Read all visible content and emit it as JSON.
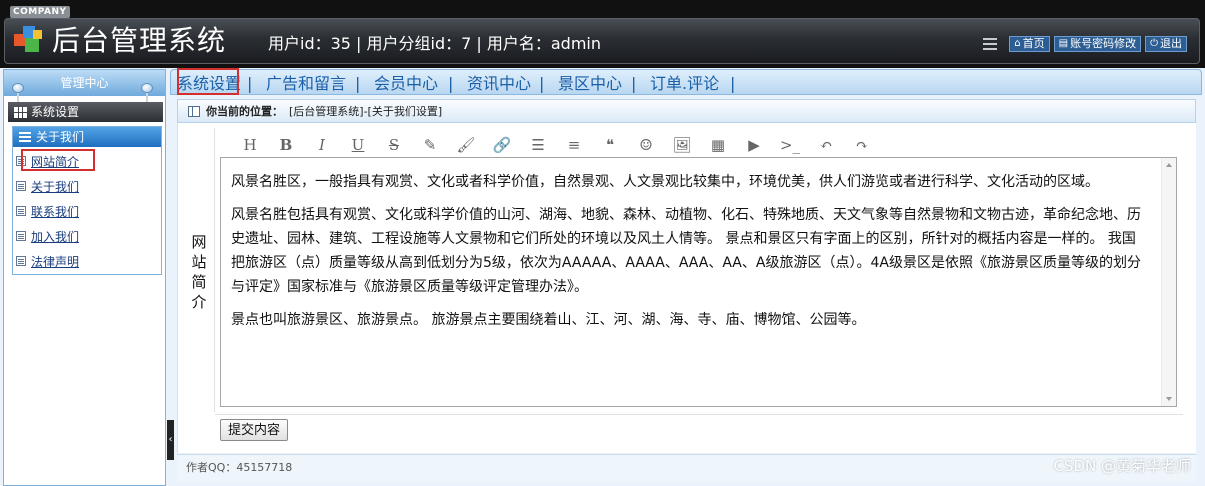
{
  "header": {
    "company": "COMPANY",
    "title": "后台管理系统",
    "user_info": "用户id：35 | 用户分组id：7 | 用户名：admin",
    "links": [
      {
        "label": "首页",
        "icon": "home-icon"
      },
      {
        "label": "账号密码修改",
        "icon": "account-icon"
      },
      {
        "label": "退出",
        "icon": "power-icon"
      }
    ]
  },
  "sidebar": {
    "title": "管理中心",
    "section": "系统设置",
    "group": "关于我们",
    "items": [
      "网站简介",
      "关于我们",
      "联系我们",
      "加入我们",
      "法律声明"
    ]
  },
  "nav": {
    "items": [
      "系统设置",
      "广告和留言",
      "会员中心",
      "资讯中心",
      "景区中心",
      "订单.评论"
    ],
    "separator": "|"
  },
  "breadcrumb": {
    "label": "你当前的位置：",
    "path": "[后台管理系统]-[关于我们设置]"
  },
  "form": {
    "field_label": "网站简介",
    "toolbar": [
      "H",
      "B",
      "I",
      "U",
      "S",
      "✎",
      "🖌",
      "🔗",
      "☰",
      "≡",
      "❝",
      "☺",
      "🖼",
      "▦",
      "▶",
      ">_",
      "↶",
      "↷"
    ],
    "content": [
      "风景名胜区，一般指具有观赏、文化或者科学价值，自然景观、人文景观比较集中，环境优美，供人们游览或者进行科学、文化活动的区域。",
      "风景名胜包括具有观赏、文化或科学价值的山河、湖海、地貌、森林、动植物、化石、特殊地质、天文气象等自然景物和文物古迹，革命纪念地、历史遗址、园林、建筑、工程设施等人文景物和它们所处的环境以及风土人情等。 景点和景区只有字面上的区别，所针对的概括内容是一样的。 我国把旅游区（点）质量等级从高到低划分为5级，依次为AAAAA、AAAA、AAA、AA、A级旅游区（点）。4A级景区是依照《旅游景区质量等级的划分与评定》国家标准与《旅游景区质量等级评定管理办法》。",
      "景点也叫旅游景区、旅游景点。 旅游景点主要围绕着山、江、河、湖、海、寺、庙、博物馆、公园等。"
    ],
    "submit_label": "提交内容"
  },
  "footer": {
    "author_qq": "作者QQ：45157718"
  },
  "watermark": "CSDN @黄菊华老师",
  "colors": {
    "highlight": "#d32f2f",
    "nav_link": "#1a5fa8",
    "header_bg": "#2a2e33",
    "sidebar_accent": "#1f6fbf"
  }
}
